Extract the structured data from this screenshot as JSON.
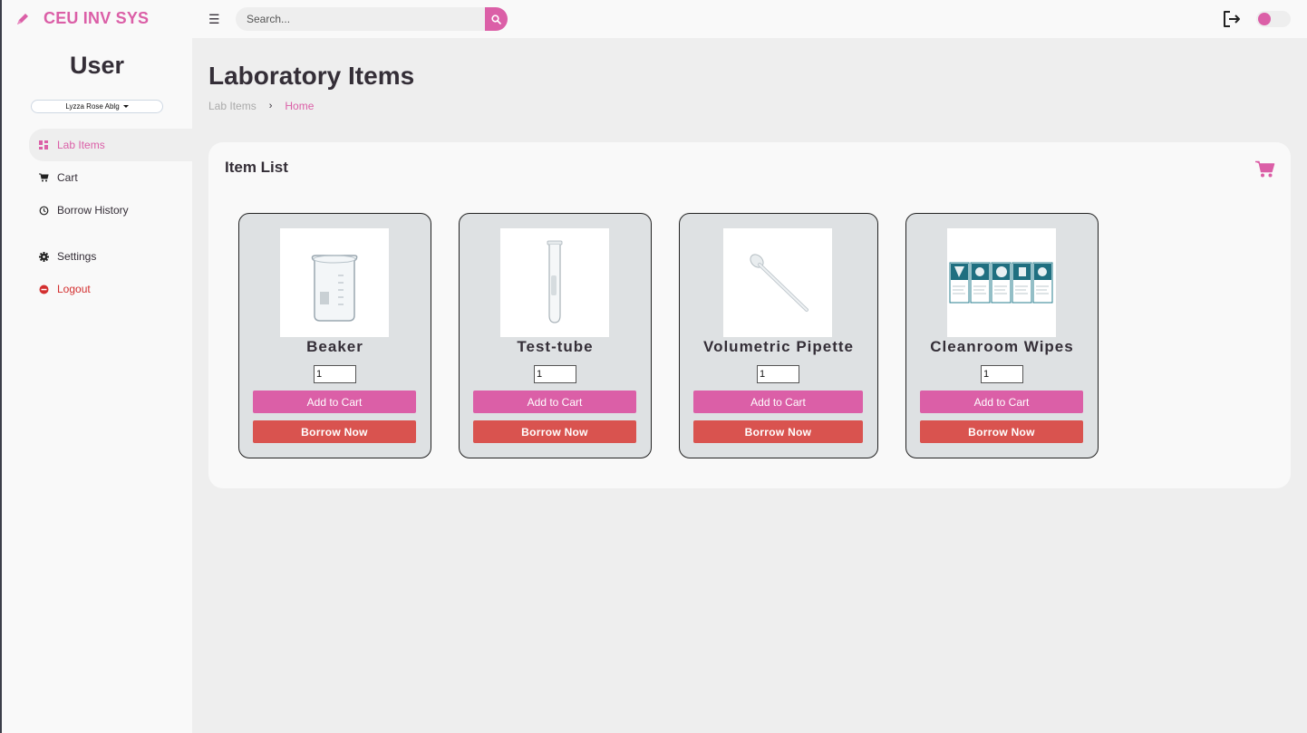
{
  "topbar": {
    "brand": "CEU INV SYS",
    "search_placeholder": "Search..."
  },
  "sidebar": {
    "title": "User",
    "user_name": "Lyzza Rose Ablg",
    "items": [
      {
        "label": "Lab Items",
        "icon": "grid-icon"
      },
      {
        "label": "Cart",
        "icon": "cart-icon"
      },
      {
        "label": "Borrow History",
        "icon": "history-icon"
      },
      {
        "label": "Settings",
        "icon": "gear-icon"
      },
      {
        "label": "Logout",
        "icon": "logout-icon"
      }
    ]
  },
  "main": {
    "title": "Laboratory Items",
    "breadcrumb": [
      "Lab Items",
      "Home"
    ],
    "panel_title": "Item List"
  },
  "items": [
    {
      "name": "Beaker",
      "qty": "1",
      "add_label": "Add to Cart",
      "borrow_label": "Borrow Now"
    },
    {
      "name": "Test-tube",
      "qty": "1",
      "add_label": "Add to Cart",
      "borrow_label": "Borrow Now"
    },
    {
      "name": "Volumetric Pipette",
      "qty": "1",
      "add_label": "Add to Cart",
      "borrow_label": "Borrow Now"
    },
    {
      "name": "Cleanroom Wipes",
      "qty": "1",
      "add_label": "Add to Cart",
      "borrow_label": "Borrow Now"
    }
  ],
  "colors": {
    "accent": "#db5fa7",
    "danger": "#d9534f",
    "card_bg": "#dee1e3"
  }
}
